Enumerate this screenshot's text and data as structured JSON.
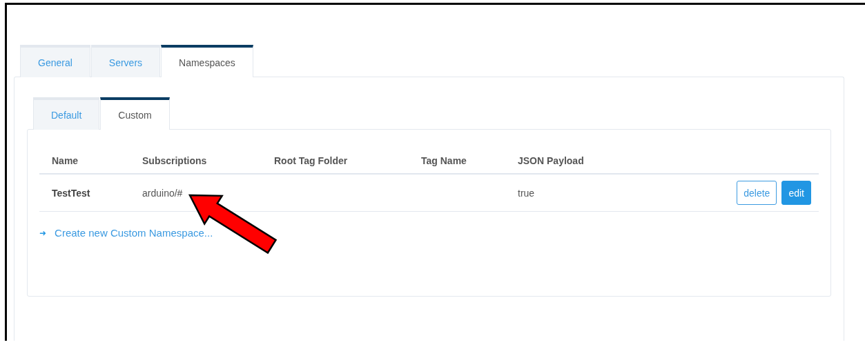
{
  "tabs": [
    {
      "label": "General",
      "selected": false
    },
    {
      "label": "Servers",
      "selected": false
    },
    {
      "label": "Namespaces",
      "selected": true
    }
  ],
  "subtabs": [
    {
      "label": "Default",
      "selected": false
    },
    {
      "label": "Custom",
      "selected": true
    }
  ],
  "table": {
    "columns": [
      "Name",
      "Subscriptions",
      "Root Tag Folder",
      "Tag Name",
      "JSON Payload"
    ],
    "rows": [
      {
        "cells": [
          "TestTest",
          "arduino/#",
          "",
          "",
          "true"
        ],
        "actions": [
          {
            "kind": "outline",
            "label": "delete"
          },
          {
            "kind": "primary",
            "label": "edit"
          }
        ]
      }
    ]
  },
  "create_link": {
    "icon": "➜",
    "label": "Create new Custom Namespace..."
  }
}
